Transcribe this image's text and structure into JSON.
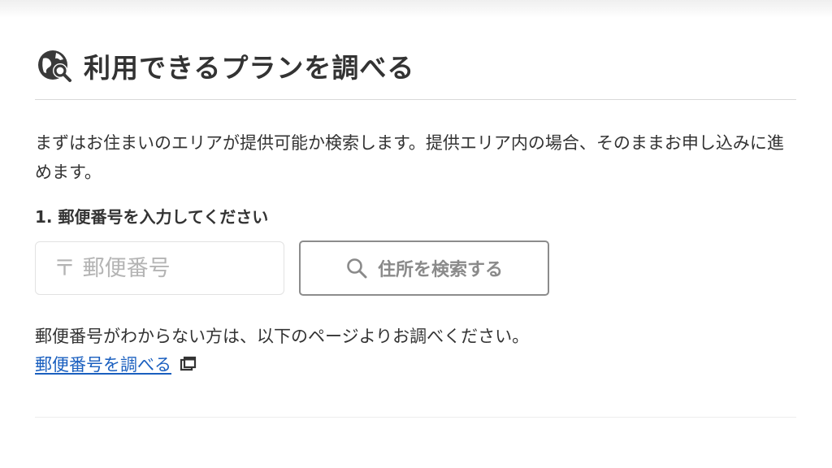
{
  "section": {
    "title": "利用できるプランを調べる",
    "icon": "globe-search-icon",
    "description": "まずはお住まいのエリアが提供可能か検索します。提供エリア内の場合、そのままお申し込みに進めます。"
  },
  "step1": {
    "label": "1. 郵便番号を入力してください",
    "zip_input": {
      "placeholder": "〒 郵便番号",
      "value": ""
    },
    "search_button": {
      "label": "住所を検索する",
      "icon": "search-icon"
    }
  },
  "help": {
    "text": "郵便番号がわからない方は、以下のページよりお調べください。",
    "link_label": "郵便番号を調べる",
    "link_icon": "external-window-icon"
  },
  "colors": {
    "text": "#333333",
    "link": "#1a5fbf",
    "button_border": "#8c8c8c",
    "placeholder": "#b4b4b4"
  }
}
